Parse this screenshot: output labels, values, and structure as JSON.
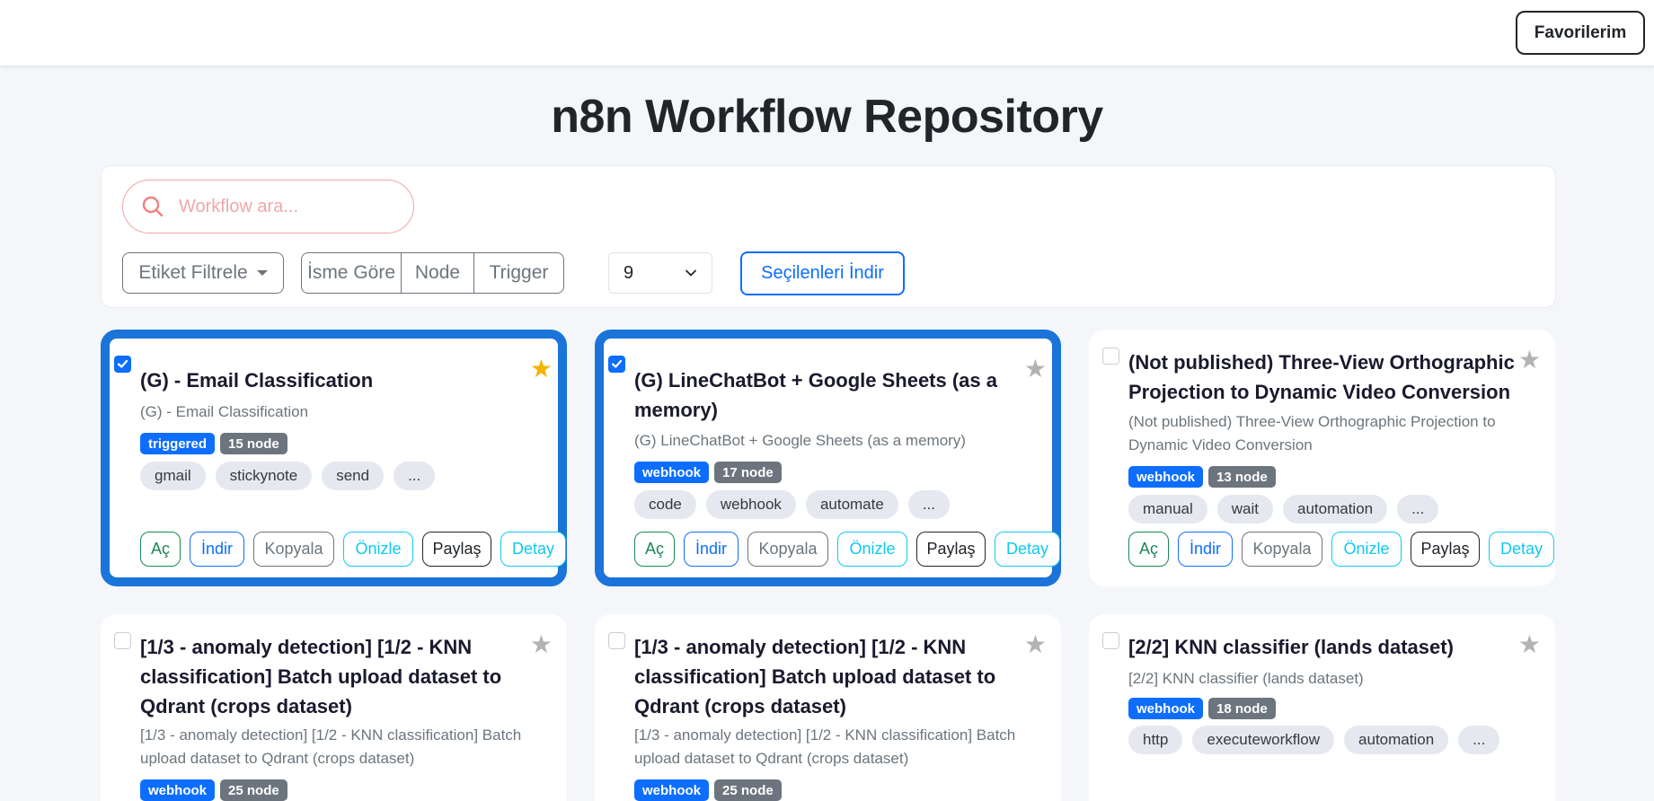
{
  "header": {
    "favorites_label": "Favorilerim"
  },
  "page_title": "n8n Workflow Repository",
  "controls": {
    "search_placeholder": "Workflow ara...",
    "tag_filter_label": "Etiket Filtrele",
    "sort_options": [
      "İsme Göre",
      "Node",
      "Trigger"
    ],
    "page_size": "9",
    "download_selected_label": "Seçilenleri İndir"
  },
  "action_labels": [
    "Aç",
    "İndir",
    "Kopyala",
    "Önizle",
    "Paylaş",
    "Detay"
  ],
  "cards": [
    {
      "selected": true,
      "favorite": true,
      "title": "(G) - Email Classification",
      "subtitle": "(G) - Email Classification",
      "trigger": "triggered",
      "nodes": "15 node",
      "tags": [
        "gmail",
        "stickynote",
        "send",
        "..."
      ]
    },
    {
      "selected": true,
      "favorite": false,
      "title": "(G) LineChatBot + Google Sheets (as a memory)",
      "subtitle": "(G) LineChatBot + Google Sheets (as a memory)",
      "trigger": "webhook",
      "nodes": "17 node",
      "tags": [
        "code",
        "webhook",
        "automate",
        "..."
      ]
    },
    {
      "selected": false,
      "favorite": false,
      "title": "(Not published) Three-View Orthographic Projection to Dynamic Video Conversion",
      "subtitle": "(Not published) Three-View Orthographic Projection to Dynamic Video Conversion",
      "trigger": "webhook",
      "nodes": "13 node",
      "tags": [
        "manual",
        "wait",
        "automation",
        "..."
      ]
    },
    {
      "selected": false,
      "favorite": false,
      "title": "[1/3 - anomaly detection] [1/2 - KNN classification] Batch upload dataset to Qdrant (crops dataset)",
      "subtitle": "[1/3 - anomaly detection] [1/2 - KNN classification] Batch upload dataset to Qdrant (crops dataset)",
      "trigger": "webhook",
      "nodes": "25 node",
      "tags": []
    },
    {
      "selected": false,
      "favorite": false,
      "title": "[1/3 - anomaly detection] [1/2 - KNN classification] Batch upload dataset to Qdrant (crops dataset)",
      "subtitle": "[1/3 - anomaly detection] [1/2 - KNN classification] Batch upload dataset to Qdrant (crops dataset)",
      "trigger": "webhook",
      "nodes": "25 node",
      "tags": []
    },
    {
      "selected": false,
      "favorite": false,
      "title": "[2/2] KNN classifier (lands dataset)",
      "subtitle": "[2/2] KNN classifier (lands dataset)",
      "trigger": "webhook",
      "nodes": "18 node",
      "tags": [
        "http",
        "executeworkflow",
        "automation",
        "..."
      ]
    }
  ],
  "colors": {
    "primary": "#0d6efd",
    "selected_border": "#1a74d9",
    "favorite_star": "#f5b301",
    "success": "#198754",
    "info": "#0dcaf0"
  }
}
